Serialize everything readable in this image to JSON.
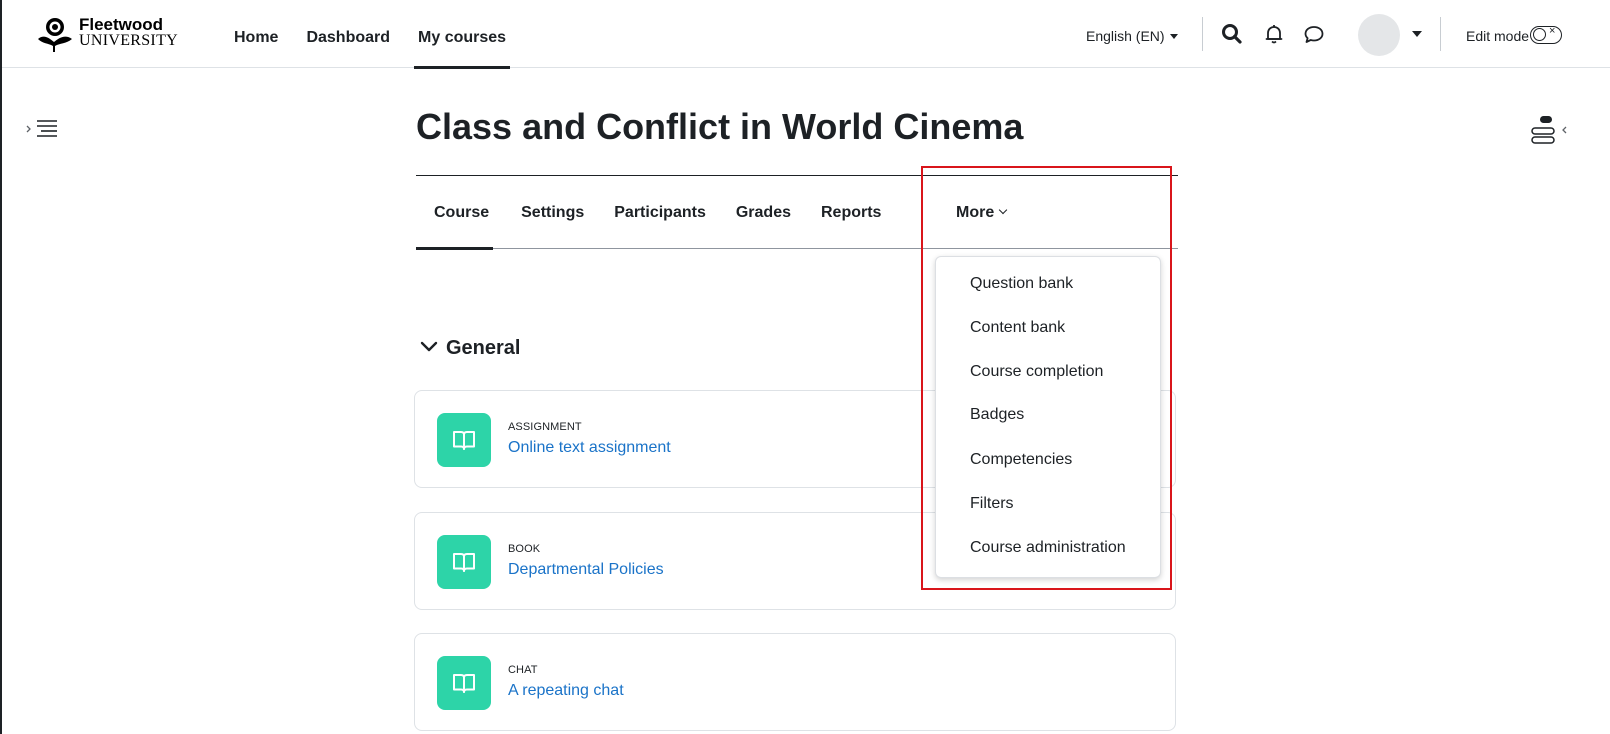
{
  "brand": {
    "name": "Fleetwood",
    "sub": "UNIVERSITY"
  },
  "primary_nav": [
    {
      "label": "Home",
      "active": false
    },
    {
      "label": "Dashboard",
      "active": false
    },
    {
      "label": "My courses",
      "active": true
    }
  ],
  "header": {
    "language": "English (EN)",
    "edit_mode_label": "Edit mode",
    "edit_mode_on": false,
    "icons": [
      "search-icon",
      "notification-bell-icon",
      "messages-icon"
    ]
  },
  "course": {
    "title": "Class and Conflict in World Cinema"
  },
  "secondary_nav": {
    "tabs": [
      {
        "label": "Course",
        "active": true
      },
      {
        "label": "Settings",
        "active": false
      },
      {
        "label": "Participants",
        "active": false
      },
      {
        "label": "Grades",
        "active": false
      },
      {
        "label": "Reports",
        "active": false
      }
    ],
    "more_label": "More"
  },
  "more_menu": {
    "items": [
      "Question bank",
      "Content bank",
      "Course completion",
      "Badges",
      "Competencies",
      "Filters",
      "Course administration"
    ]
  },
  "section": {
    "title": "General",
    "expanded": true
  },
  "activities": [
    {
      "type": "ASSIGNMENT",
      "name": "Online text assignment"
    },
    {
      "type": "BOOK",
      "name": "Departmental Policies"
    },
    {
      "type": "CHAT",
      "name": "A repeating chat"
    }
  ],
  "colors": {
    "activity_icon_bg": "#2dd4a8",
    "link": "#1a73c8",
    "highlight_box": "#d9151b",
    "text": "#1d2125"
  }
}
